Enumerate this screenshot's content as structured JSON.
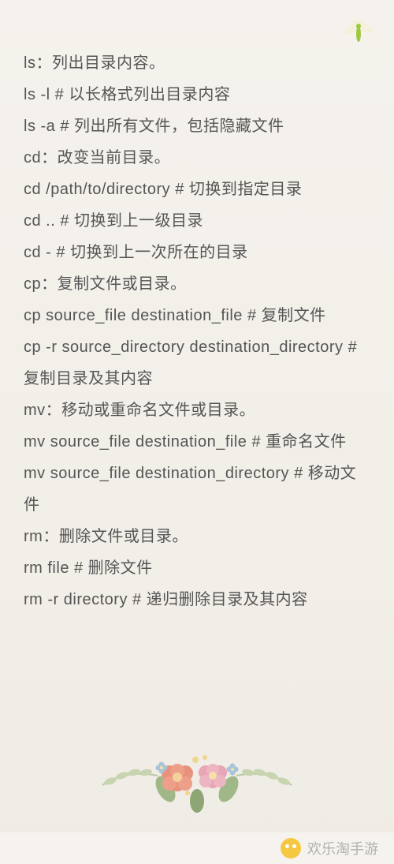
{
  "lines": [
    "ls：列出目录内容。",
    " ls -l # 以长格式列出目录内容",
    " ls -a # 列出所有文件，包括隐藏文件",
    "cd：改变当前目录。",
    " cd /path/to/directory # 切换到指定目录",
    " cd .. # 切换到上一级目录",
    " cd - # 切换到上一次所在的目录",
    "cp：复制文件或目录。",
    " cp source_file destination_file # 复制文件",
    " cp -r source_directory destination_directory # 复制目录及其内容",
    "mv：移动或重命名文件或目录。",
    " mv source_file destination_file # 重命名文件",
    " mv source_file destination_directory # 移动文件",
    "rm：删除文件或目录。",
    " rm file # 删除文件",
    " rm -r directory # 递归删除目录及其内容"
  ],
  "footer": {
    "text": "欢乐淘手游"
  }
}
